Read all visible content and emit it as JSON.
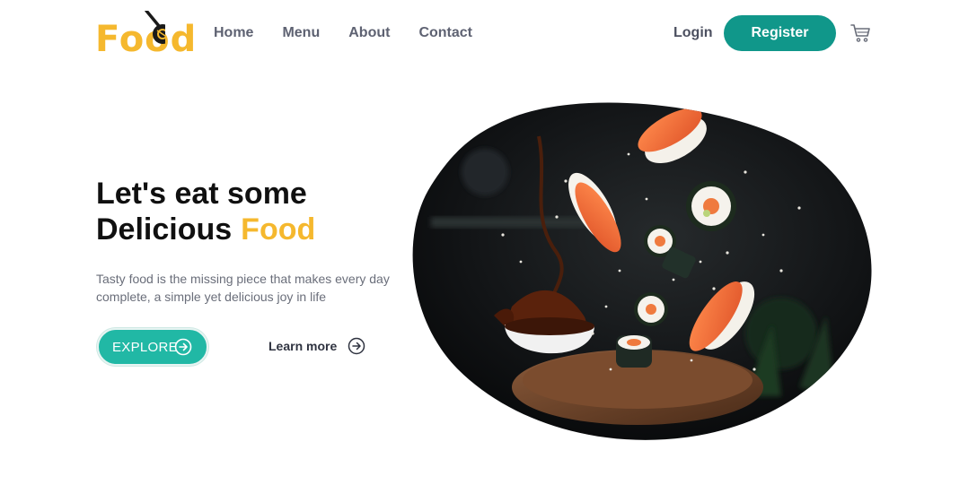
{
  "brand": {
    "logo_text": "Food",
    "accent": "#f5b82e",
    "teal": "#10978a"
  },
  "nav": {
    "items": [
      {
        "label": "Home"
      },
      {
        "label": "Menu"
      },
      {
        "label": "About"
      },
      {
        "label": "Contact"
      }
    ]
  },
  "auth": {
    "login_label": "Login",
    "register_label": "Register"
  },
  "hero": {
    "title_line1": "Let's eat some",
    "title_line2": "Delicious",
    "title_accent": "Food",
    "description": "Tasty food is the missing piece that makes every day complete, a simple yet delicious joy in life",
    "explore_label": "EXPLORE",
    "learn_more_label": "Learn more"
  },
  "icons": {
    "cart": "cart-icon",
    "arrow": "arrow-right-circle-icon",
    "logo_mark": "utensil-icon"
  }
}
